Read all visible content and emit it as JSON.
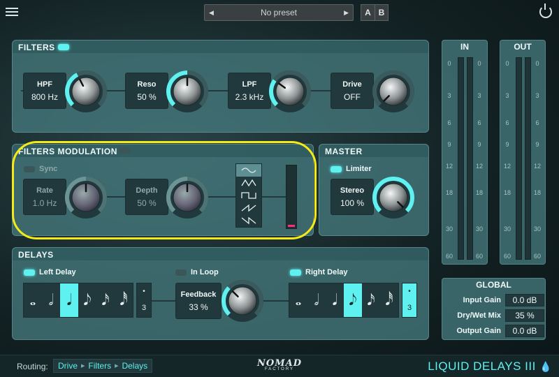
{
  "topbar": {
    "preset_name": "No preset",
    "btn_a": "A",
    "btn_b": "B"
  },
  "filters": {
    "title": "FILTERS",
    "enabled": true,
    "hpf": {
      "label": "HPF",
      "value": "800 Hz",
      "level": 0.4
    },
    "reso": {
      "label": "Reso",
      "value": "50 %",
      "level": 0.5
    },
    "lpf": {
      "label": "LPF",
      "value": "2.3 kHz",
      "level": 0.3
    },
    "drive": {
      "label": "Drive",
      "value": "OFF",
      "level": 0.0
    }
  },
  "filters_mod": {
    "title": "FILTERS MODULATION",
    "enabled": false,
    "sync_label": "Sync",
    "sync_on": false,
    "rate": {
      "label": "Rate",
      "value": "1.0 Hz",
      "level": 0.5
    },
    "depth": {
      "label": "Depth",
      "value": "50 %",
      "level": 0.5
    },
    "waveforms": [
      "sine",
      "triangle",
      "square",
      "saw-up",
      "saw-down"
    ],
    "selected_waveform": "sine"
  },
  "master": {
    "title": "MASTER",
    "limiter_label": "Limiter",
    "limiter_on": true,
    "stereo": {
      "label": "Stereo",
      "value": "100 %",
      "level": 1.0
    }
  },
  "delays": {
    "title": "DELAYS",
    "left_label": "Left Delay",
    "left_on": true,
    "in_loop_label": "In Loop",
    "in_loop_on": false,
    "right_label": "Right Delay",
    "right_on": true,
    "feedback": {
      "label": "Feedback",
      "value": "33 %",
      "level": 0.33
    },
    "triplet_label": "3",
    "left_selected_note": 2,
    "right_selected_note": 3,
    "left_triplet_on": false,
    "right_triplet_on": true
  },
  "meters": {
    "in_title": "IN",
    "out_title": "OUT",
    "ticks": [
      "0",
      "3",
      "6",
      "9",
      "12",
      "18",
      "30",
      "60"
    ]
  },
  "global": {
    "title": "GLOBAL",
    "rows": [
      {
        "label": "Input Gain",
        "value": "0.0 dB"
      },
      {
        "label": "Dry/Wet Mix",
        "value": "35 %"
      },
      {
        "label": "Output Gain",
        "value": "0.0 dB"
      }
    ]
  },
  "bottom": {
    "routing_label": "Routing:",
    "routing": [
      "Drive",
      "Filters",
      "Delays"
    ],
    "logo_main": "NOMAD",
    "logo_sub": "FACTORY",
    "product": "LIQUID DELAYS III"
  },
  "colors": {
    "accent": "#5ff0f0",
    "panel": "#45787c",
    "box": "#21393c",
    "mod_meter": "#ff2e7a",
    "highlight": "#f4ea18"
  }
}
